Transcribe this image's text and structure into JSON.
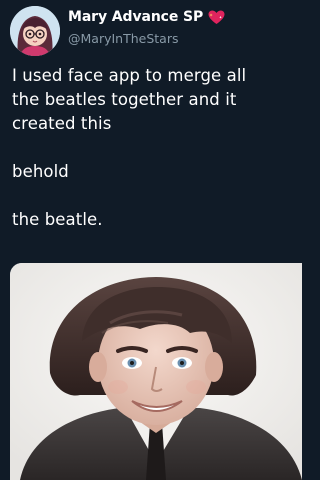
{
  "tweet": {
    "author": {
      "display_name": "Mary Advance SP",
      "handle": "@MaryInTheStars",
      "avatar_icon": "cartoon-girl-avatar",
      "badge_icon": "sparkling-heart-icon"
    },
    "text_lines": [
      "I used face app to merge all",
      "the beatles together and it",
      "created this",
      "behold",
      "the beatle."
    ],
    "media": {
      "type": "photo"
    }
  },
  "colors": {
    "background": "#101b27",
    "text_primary": "#ffffff",
    "text_secondary": "#8899a6",
    "heart": "#e0245e"
  }
}
